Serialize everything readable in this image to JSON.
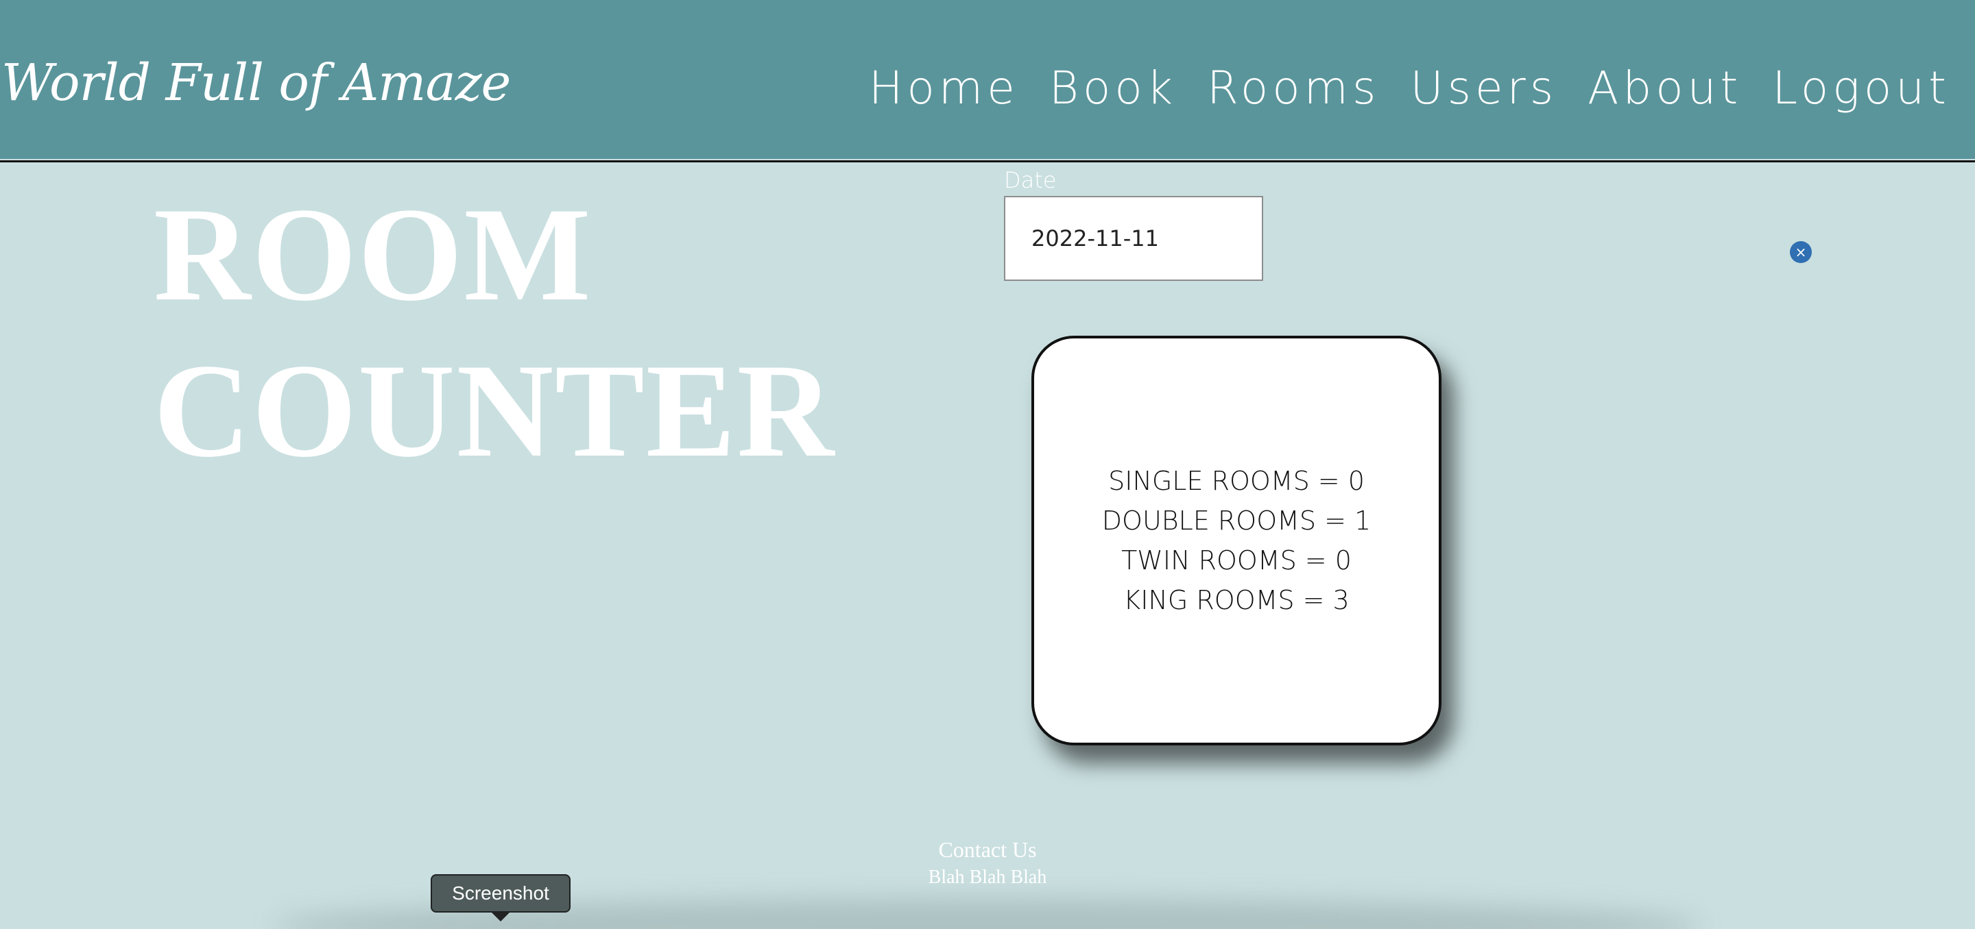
{
  "header": {
    "brand": "World Full of Amaze",
    "nav": [
      {
        "label": "Home"
      },
      {
        "label": "Book"
      },
      {
        "label": "Rooms"
      },
      {
        "label": "Users"
      },
      {
        "label": "About"
      },
      {
        "label": "Logout"
      }
    ]
  },
  "hero": {
    "line1": "ROOM",
    "line2": "COUNTER"
  },
  "date_field": {
    "label": "Date",
    "value": "2022-11-11"
  },
  "close_button": {
    "symbol": "×"
  },
  "room_counts": [
    {
      "text": "SINGLE ROOMS = 0"
    },
    {
      "text": "DOUBLE ROOMS = 1"
    },
    {
      "text": "TWIN ROOMS = 0"
    },
    {
      "text": "KING ROOMS = 3"
    }
  ],
  "footer": {
    "title": "Contact Us",
    "text": "Blah Blah Blah"
  },
  "tooltip": {
    "label": "Screenshot"
  },
  "colors": {
    "header_bg": "#5a959b",
    "page_bg": "#cadfe0",
    "close_button": "#2f6fb2"
  }
}
